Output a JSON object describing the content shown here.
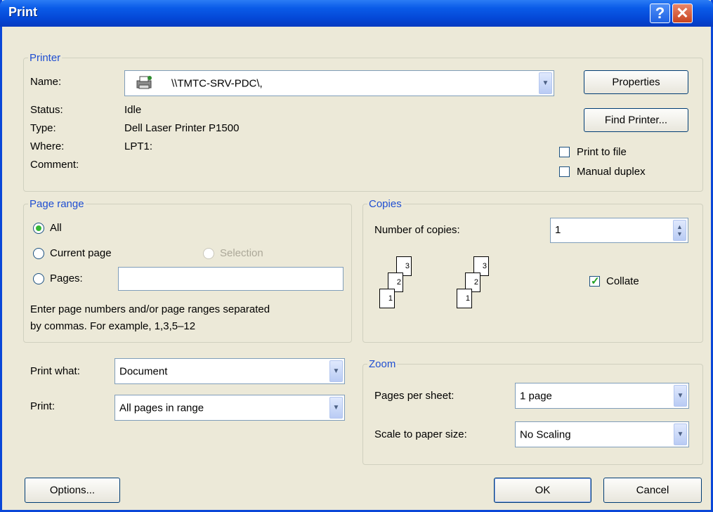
{
  "window": {
    "title": "Print",
    "help_icon": "?",
    "close_icon": "✕"
  },
  "printer": {
    "legend": "Printer",
    "name_label": "Name:",
    "name_value": "\\\\TMTC-SRV-PDC\\,",
    "status_label": "Status:",
    "status_value": "Idle",
    "type_label": "Type:",
    "type_value": "Dell Laser Printer P1500",
    "where_label": "Where:",
    "where_value": "LPT1:",
    "comment_label": "Comment:",
    "properties_label": "Properties",
    "find_printer_label": "Find Printer...",
    "print_to_file_label": "Print to file",
    "manual_duplex_label": "Manual duplex"
  },
  "page_range": {
    "legend": "Page range",
    "all_label": "All",
    "current_page_label": "Current page",
    "selection_label": "Selection",
    "pages_label": "Pages:",
    "pages_value": "",
    "hint_line1": "Enter page numbers and/or page ranges separated",
    "hint_line2": "by commas.  For example, 1,3,5–12"
  },
  "copies": {
    "legend": "Copies",
    "number_label": "Number of copies:",
    "number_value": "1",
    "collate_label": "Collate",
    "collate_checked": true,
    "stack_pages": [
      "3",
      "2",
      "1"
    ]
  },
  "print_what": {
    "label": "Print what:",
    "value": "Document"
  },
  "print": {
    "label": "Print:",
    "value": "All pages in range"
  },
  "zoom": {
    "legend": "Zoom",
    "pages_per_sheet_label": "Pages per sheet:",
    "pages_per_sheet_value": "1 page",
    "scale_label": "Scale to paper size:",
    "scale_value": "No Scaling"
  },
  "buttons": {
    "options": "Options...",
    "ok": "OK",
    "cancel": "Cancel"
  },
  "colors": {
    "accent": "#1f4ed1",
    "titlebar": "#0a5be8",
    "dialog_bg": "#ece9d8"
  }
}
